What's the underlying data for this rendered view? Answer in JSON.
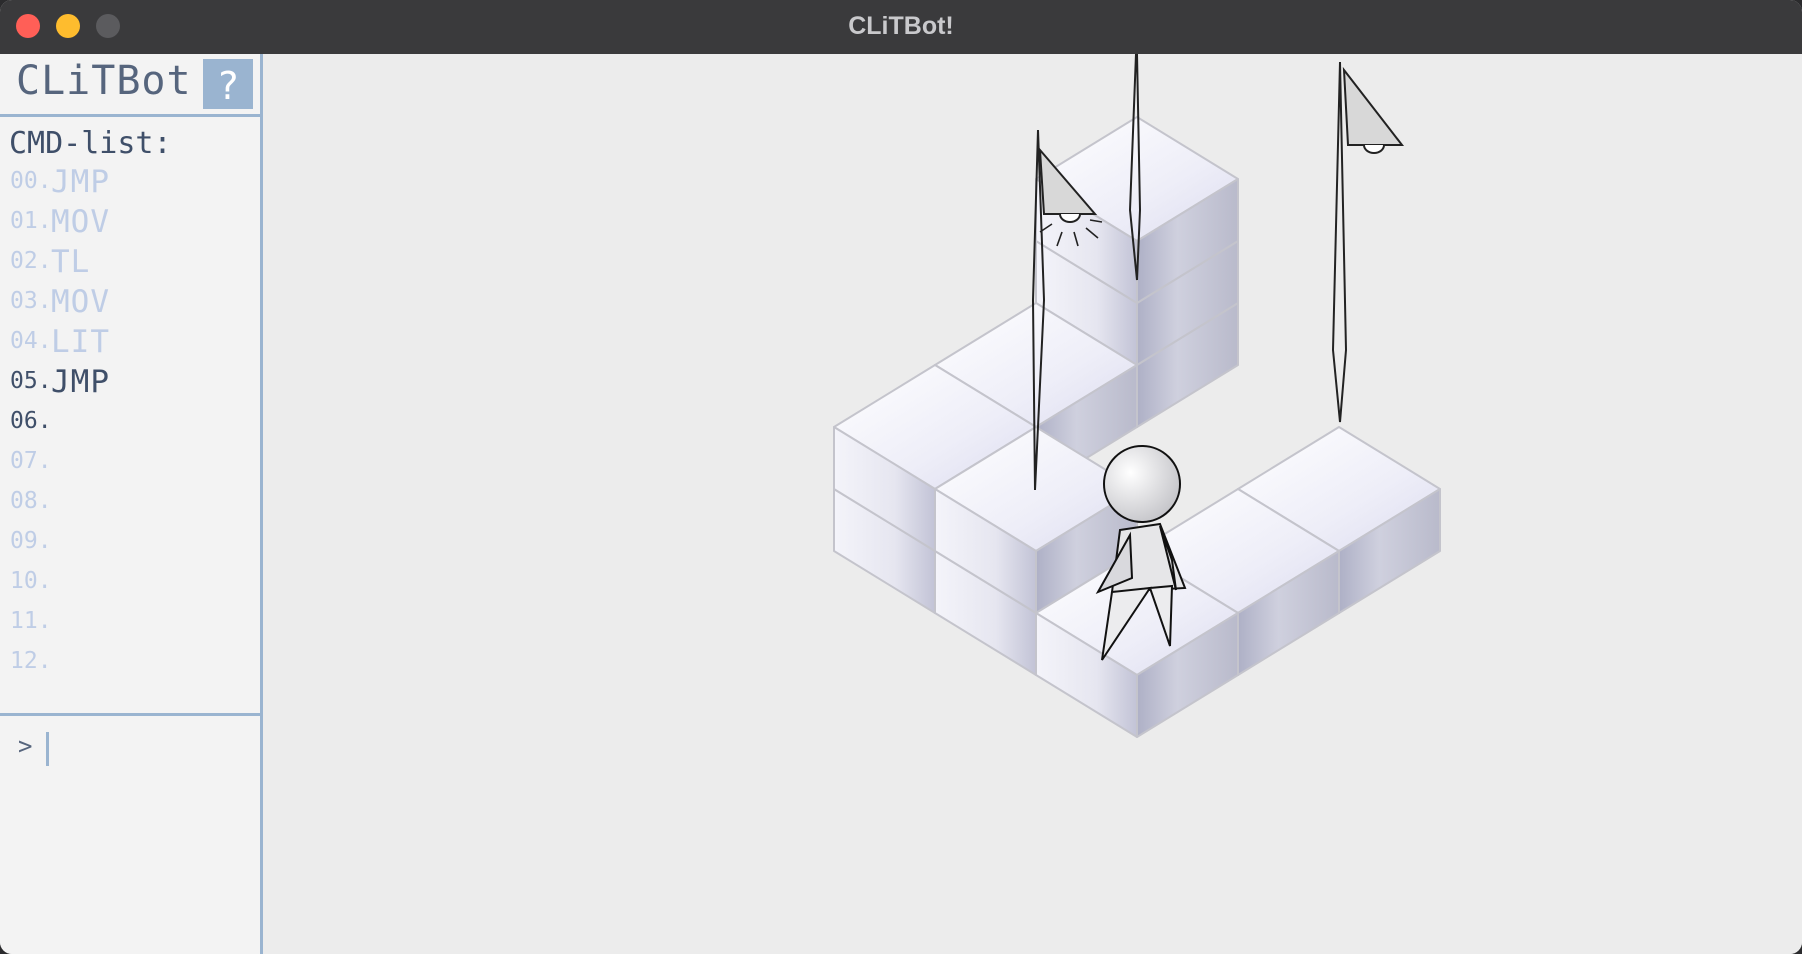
{
  "window": {
    "title": "CLiTBot!"
  },
  "brand": {
    "title": "CLiTBot!",
    "help_label": "?"
  },
  "commands": {
    "header": "CMD-list:",
    "items": [
      {
        "num": "00.",
        "name": "JMP"
      },
      {
        "num": "01.",
        "name": "MOV"
      },
      {
        "num": "02.",
        "name": "TL"
      },
      {
        "num": "03.",
        "name": "MOV"
      },
      {
        "num": "04.",
        "name": "LIT"
      },
      {
        "num": "05.",
        "name": "JMP"
      },
      {
        "num": "06.",
        "name": ""
      },
      {
        "num": "07.",
        "name": ""
      },
      {
        "num": "08.",
        "name": ""
      },
      {
        "num": "09.",
        "name": ""
      },
      {
        "num": "10.",
        "name": ""
      },
      {
        "num": "11.",
        "name": ""
      },
      {
        "num": "12.",
        "name": ""
      }
    ],
    "current_index": 5,
    "next_index": 6
  },
  "console": {
    "prompt": ">",
    "value": "",
    "placeholder": ""
  },
  "colors": {
    "accent": "#9ab4d0",
    "text_dark": "#3f4f69",
    "text_faded": "#bfcde6",
    "background": "#ececec"
  }
}
